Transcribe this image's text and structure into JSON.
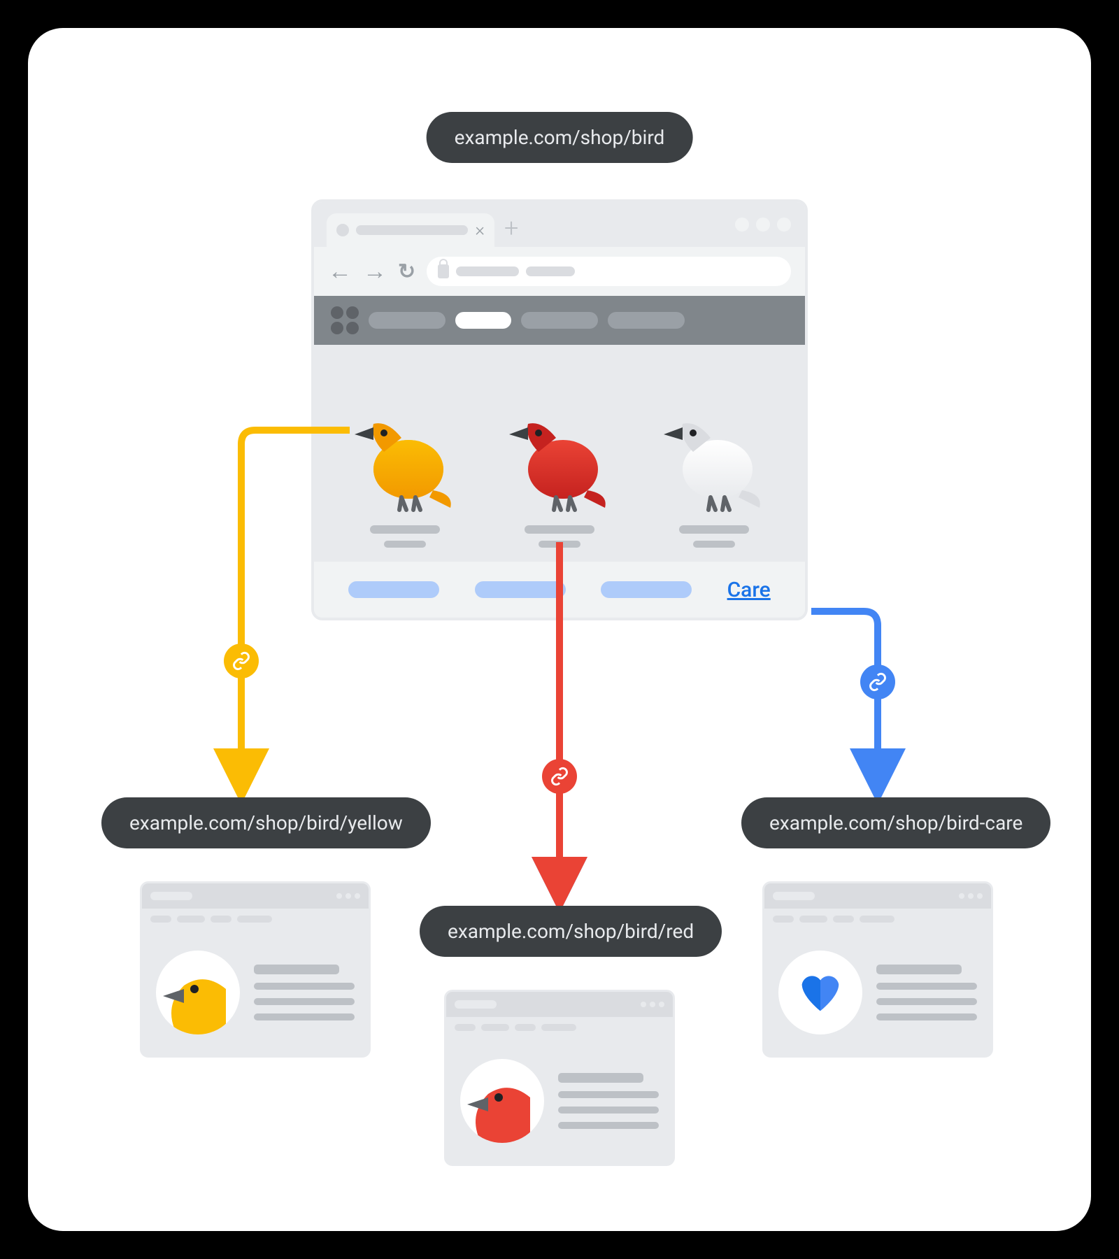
{
  "root": {
    "url": "example.com/shop/bird",
    "products": [
      {
        "color": "yellow",
        "primary": "#fbbc04",
        "secondary": "#f29900"
      },
      {
        "color": "red",
        "primary": "#ea4335",
        "secondary": "#c5221f"
      },
      {
        "color": "white",
        "primary": "#ffffff",
        "secondary": "#dadce0"
      }
    ],
    "care_link_label": "Care"
  },
  "children": {
    "yellow": {
      "url": "example.com/shop/bird/yellow",
      "arrow_color": "#fbbc04",
      "icon": "bird-head",
      "icon_color": "#fbbc04"
    },
    "red": {
      "url": "example.com/shop/bird/red",
      "arrow_color": "#ea4335",
      "icon": "bird-head",
      "icon_color": "#ea4335"
    },
    "care": {
      "url": "example.com/shop/bird-care",
      "arrow_color": "#4285f4",
      "icon": "heart",
      "icon_color": "#4285f4"
    }
  }
}
